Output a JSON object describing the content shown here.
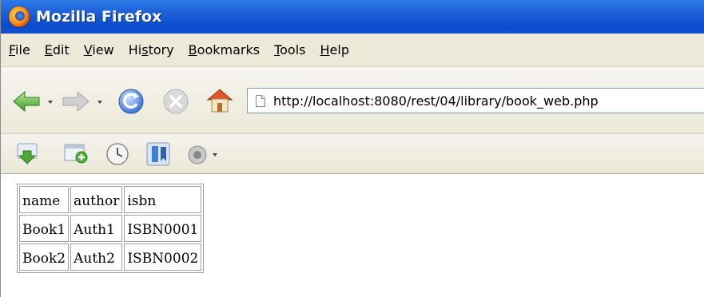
{
  "window": {
    "title": "Mozilla Firefox"
  },
  "menu": {
    "items": [
      {
        "label": "File",
        "accel": "F",
        "rest": "ile"
      },
      {
        "label": "Edit",
        "accel": "E",
        "rest": "dit"
      },
      {
        "label": "View",
        "accel": "V",
        "rest": "iew"
      },
      {
        "label": "History",
        "pre": "Hi",
        "accel": "s",
        "rest": "tory"
      },
      {
        "label": "Bookmarks",
        "accel": "B",
        "rest": "ookmarks"
      },
      {
        "label": "Tools",
        "accel": "T",
        "rest": "ools"
      },
      {
        "label": "Help",
        "accel": "H",
        "rest": "elp"
      }
    ]
  },
  "navigation": {
    "url": "http://localhost:8080/rest/04/library/book_web.php"
  },
  "table": {
    "headers": [
      "name",
      "author",
      "isbn"
    ],
    "rows": [
      [
        "Book1",
        "Auth1",
        "ISBN0001"
      ],
      [
        "Book2",
        "Auth2",
        "ISBN0002"
      ]
    ]
  },
  "colors": {
    "titlebar": "#1c5fd8",
    "chrome": "#ece9d8",
    "url_border": "#7f9db9"
  }
}
